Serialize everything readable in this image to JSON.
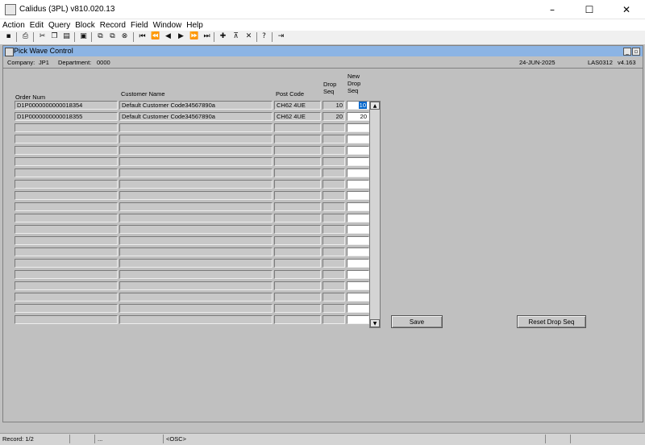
{
  "window": {
    "title": "Calidus (3PL) v810.020.13",
    "controls": [
      "–",
      "☐",
      "✕"
    ]
  },
  "menu": [
    "Action",
    "Edit",
    "Query",
    "Block",
    "Record",
    "Field",
    "Window",
    "Help"
  ],
  "toolbar_icons": [
    "save-icon",
    "print-icon",
    "cut-icon",
    "copy-icon",
    "paste-icon",
    "clear-field-icon",
    "insert-record-icon",
    "duplicate-record-icon",
    "lookup-icon",
    "first-record-icon",
    "previous-block-icon",
    "previous-record-icon",
    "next-record-icon",
    "next-block-icon",
    "last-record-icon",
    "add-icon",
    "clear-record-icon",
    "delete-record-icon",
    "help-icon",
    "exit-icon"
  ],
  "form": {
    "title": "Pick Wave Control",
    "company_label": "Company:",
    "company": "JP1",
    "department_label": "Department:",
    "department": "0000",
    "date": "24-JUN-2025",
    "form_code": "LAS0312",
    "version": "v4.163"
  },
  "columns": {
    "order_num": "Order Num",
    "customer_name": "Customer Name",
    "post_code": "Post Code",
    "drop_seq": [
      "Drop",
      "Seq"
    ],
    "new_drop_seq": [
      "New",
      "Drop",
      "Seq"
    ]
  },
  "rows": [
    {
      "order_num": "D1P0000000000018354",
      "customer_name": "Default Customer Code34567890a",
      "post_code": "CH62 4UE",
      "drop_seq": "10",
      "new_drop_seq": "10"
    },
    {
      "order_num": "D1P0000000000018355",
      "customer_name": "Default Customer Code34567890a",
      "post_code": "CH62 4UE",
      "drop_seq": "20",
      "new_drop_seq": "20"
    }
  ],
  "buttons": {
    "save": "Save",
    "reset": "Reset Drop Seq"
  },
  "status": {
    "record": "Record: 1/2",
    "dots": "...",
    "mode": "<OSC>"
  },
  "colors": {
    "frame_title": "#8cb4e4",
    "selection": "#0066cc",
    "background": "#c0c0c0"
  }
}
